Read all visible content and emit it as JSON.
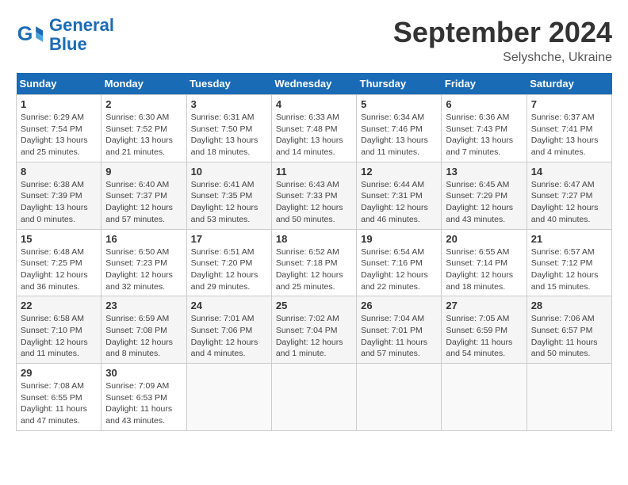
{
  "logo": {
    "line1": "General",
    "line2": "Blue"
  },
  "title": "September 2024",
  "subtitle": "Selyshche, Ukraine",
  "days_of_week": [
    "Sunday",
    "Monday",
    "Tuesday",
    "Wednesday",
    "Thursday",
    "Friday",
    "Saturday"
  ],
  "weeks": [
    [
      {
        "day": 1,
        "lines": [
          "Sunrise: 6:29 AM",
          "Sunset: 7:54 PM",
          "Daylight: 13 hours",
          "and 25 minutes."
        ]
      },
      {
        "day": 2,
        "lines": [
          "Sunrise: 6:30 AM",
          "Sunset: 7:52 PM",
          "Daylight: 13 hours",
          "and 21 minutes."
        ]
      },
      {
        "day": 3,
        "lines": [
          "Sunrise: 6:31 AM",
          "Sunset: 7:50 PM",
          "Daylight: 13 hours",
          "and 18 minutes."
        ]
      },
      {
        "day": 4,
        "lines": [
          "Sunrise: 6:33 AM",
          "Sunset: 7:48 PM",
          "Daylight: 13 hours",
          "and 14 minutes."
        ]
      },
      {
        "day": 5,
        "lines": [
          "Sunrise: 6:34 AM",
          "Sunset: 7:46 PM",
          "Daylight: 13 hours",
          "and 11 minutes."
        ]
      },
      {
        "day": 6,
        "lines": [
          "Sunrise: 6:36 AM",
          "Sunset: 7:43 PM",
          "Daylight: 13 hours",
          "and 7 minutes."
        ]
      },
      {
        "day": 7,
        "lines": [
          "Sunrise: 6:37 AM",
          "Sunset: 7:41 PM",
          "Daylight: 13 hours",
          "and 4 minutes."
        ]
      }
    ],
    [
      {
        "day": 8,
        "lines": [
          "Sunrise: 6:38 AM",
          "Sunset: 7:39 PM",
          "Daylight: 13 hours",
          "and 0 minutes."
        ]
      },
      {
        "day": 9,
        "lines": [
          "Sunrise: 6:40 AM",
          "Sunset: 7:37 PM",
          "Daylight: 12 hours",
          "and 57 minutes."
        ]
      },
      {
        "day": 10,
        "lines": [
          "Sunrise: 6:41 AM",
          "Sunset: 7:35 PM",
          "Daylight: 12 hours",
          "and 53 minutes."
        ]
      },
      {
        "day": 11,
        "lines": [
          "Sunrise: 6:43 AM",
          "Sunset: 7:33 PM",
          "Daylight: 12 hours",
          "and 50 minutes."
        ]
      },
      {
        "day": 12,
        "lines": [
          "Sunrise: 6:44 AM",
          "Sunset: 7:31 PM",
          "Daylight: 12 hours",
          "and 46 minutes."
        ]
      },
      {
        "day": 13,
        "lines": [
          "Sunrise: 6:45 AM",
          "Sunset: 7:29 PM",
          "Daylight: 12 hours",
          "and 43 minutes."
        ]
      },
      {
        "day": 14,
        "lines": [
          "Sunrise: 6:47 AM",
          "Sunset: 7:27 PM",
          "Daylight: 12 hours",
          "and 40 minutes."
        ]
      }
    ],
    [
      {
        "day": 15,
        "lines": [
          "Sunrise: 6:48 AM",
          "Sunset: 7:25 PM",
          "Daylight: 12 hours",
          "and 36 minutes."
        ]
      },
      {
        "day": 16,
        "lines": [
          "Sunrise: 6:50 AM",
          "Sunset: 7:23 PM",
          "Daylight: 12 hours",
          "and 32 minutes."
        ]
      },
      {
        "day": 17,
        "lines": [
          "Sunrise: 6:51 AM",
          "Sunset: 7:20 PM",
          "Daylight: 12 hours",
          "and 29 minutes."
        ]
      },
      {
        "day": 18,
        "lines": [
          "Sunrise: 6:52 AM",
          "Sunset: 7:18 PM",
          "Daylight: 12 hours",
          "and 25 minutes."
        ]
      },
      {
        "day": 19,
        "lines": [
          "Sunrise: 6:54 AM",
          "Sunset: 7:16 PM",
          "Daylight: 12 hours",
          "and 22 minutes."
        ]
      },
      {
        "day": 20,
        "lines": [
          "Sunrise: 6:55 AM",
          "Sunset: 7:14 PM",
          "Daylight: 12 hours",
          "and 18 minutes."
        ]
      },
      {
        "day": 21,
        "lines": [
          "Sunrise: 6:57 AM",
          "Sunset: 7:12 PM",
          "Daylight: 12 hours",
          "and 15 minutes."
        ]
      }
    ],
    [
      {
        "day": 22,
        "lines": [
          "Sunrise: 6:58 AM",
          "Sunset: 7:10 PM",
          "Daylight: 12 hours",
          "and 11 minutes."
        ]
      },
      {
        "day": 23,
        "lines": [
          "Sunrise: 6:59 AM",
          "Sunset: 7:08 PM",
          "Daylight: 12 hours",
          "and 8 minutes."
        ]
      },
      {
        "day": 24,
        "lines": [
          "Sunrise: 7:01 AM",
          "Sunset: 7:06 PM",
          "Daylight: 12 hours",
          "and 4 minutes."
        ]
      },
      {
        "day": 25,
        "lines": [
          "Sunrise: 7:02 AM",
          "Sunset: 7:04 PM",
          "Daylight: 12 hours",
          "and 1 minute."
        ]
      },
      {
        "day": 26,
        "lines": [
          "Sunrise: 7:04 AM",
          "Sunset: 7:01 PM",
          "Daylight: 11 hours",
          "and 57 minutes."
        ]
      },
      {
        "day": 27,
        "lines": [
          "Sunrise: 7:05 AM",
          "Sunset: 6:59 PM",
          "Daylight: 11 hours",
          "and 54 minutes."
        ]
      },
      {
        "day": 28,
        "lines": [
          "Sunrise: 7:06 AM",
          "Sunset: 6:57 PM",
          "Daylight: 11 hours",
          "and 50 minutes."
        ]
      }
    ],
    [
      {
        "day": 29,
        "lines": [
          "Sunrise: 7:08 AM",
          "Sunset: 6:55 PM",
          "Daylight: 11 hours",
          "and 47 minutes."
        ]
      },
      {
        "day": 30,
        "lines": [
          "Sunrise: 7:09 AM",
          "Sunset: 6:53 PM",
          "Daylight: 11 hours",
          "and 43 minutes."
        ]
      },
      null,
      null,
      null,
      null,
      null
    ]
  ]
}
